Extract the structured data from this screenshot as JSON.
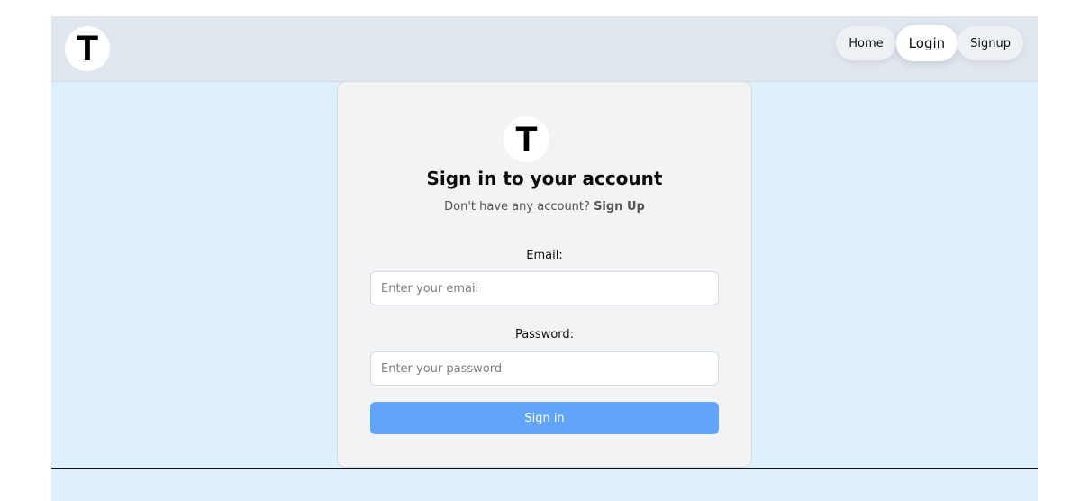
{
  "navbar": {
    "logo_letter": "T",
    "links": [
      {
        "label": "Home"
      },
      {
        "label": "Login"
      },
      {
        "label": "Signup"
      }
    ],
    "active_link": "Login"
  },
  "login_card": {
    "logo_letter": "T",
    "title": "Sign in to your account",
    "subtitle_prefix": "Don't have any account?",
    "subtitle_link": "Sign Up",
    "email_label": "Email:",
    "email_placeholder": "Enter your email",
    "email_value": "",
    "password_label": "Password:",
    "password_placeholder": "Enter your password",
    "password_value": "",
    "submit_label": "Sign in"
  },
  "colors": {
    "navbar_bg": "#e1e7ef",
    "page_bg": "#dff0fd",
    "card_bg": "#f2f3f5",
    "primary_button": "#60a5fa"
  }
}
